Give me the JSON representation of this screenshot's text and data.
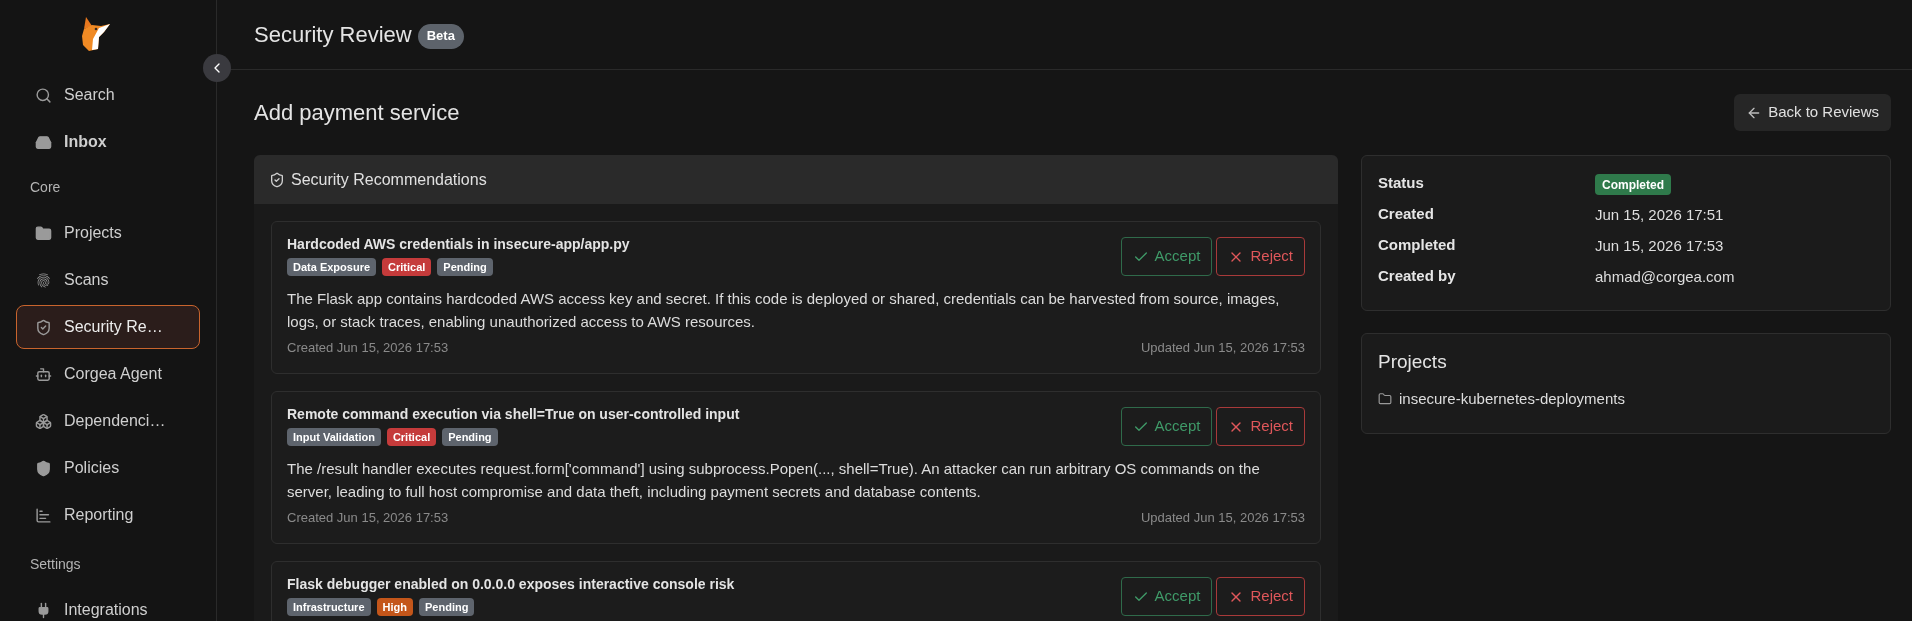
{
  "sidebar": {
    "items": [
      {
        "label": "Search",
        "selected": false,
        "unread": false
      },
      {
        "label": "Inbox",
        "selected": false,
        "unread": true
      }
    ],
    "sections": [
      {
        "title": "Core",
        "items": [
          {
            "label": "Projects",
            "selected": false,
            "unread": false
          },
          {
            "label": "Scans",
            "selected": false,
            "unread": false
          },
          {
            "label": "Security Re…",
            "selected": true,
            "unread": false
          },
          {
            "label": "Corgea Agent",
            "selected": false,
            "unread": false
          },
          {
            "label": "Dependenci…",
            "selected": false,
            "unread": false
          },
          {
            "label": "Policies",
            "selected": false,
            "unread": false
          },
          {
            "label": "Reporting",
            "selected": false,
            "unread": false
          }
        ]
      },
      {
        "title": "Settings",
        "items": [
          {
            "label": "Integrations",
            "selected": false,
            "unread": false
          }
        ]
      }
    ]
  },
  "header": {
    "title": "Security Review",
    "badge": "Beta"
  },
  "page": {
    "title": "Add payment service",
    "back_button": "Back to Reviews"
  },
  "recommendations": {
    "title": "Security Recommendations",
    "items": [
      {
        "title": "Hardcoded AWS credentials in insecure-app/app.py",
        "tags": [
          {
            "label": "Data Exposure",
            "color": "#5e646d"
          },
          {
            "label": "Critical",
            "color": "#c53b3b"
          },
          {
            "label": "Pending",
            "color": "#5e646d"
          }
        ],
        "description": "The Flask app contains hardcoded AWS access key and secret. If this code is deployed or shared, credentials can be harvested from source, images, logs, or stack traces, enabling unauthorized access to AWS resources.",
        "created": "Created Jun 15, 2026 17:53",
        "updated": "Updated Jun 15, 2026 17:53",
        "actions": [
          {
            "kind": "accept",
            "label": "Accept"
          },
          {
            "kind": "reject",
            "label": "Reject"
          }
        ]
      },
      {
        "title": "Remote command execution via shell=True on user-controlled input",
        "tags": [
          {
            "label": "Input Validation",
            "color": "#5e646d"
          },
          {
            "label": "Critical",
            "color": "#c53b3b"
          },
          {
            "label": "Pending",
            "color": "#5e646d"
          }
        ],
        "description": "The /result handler executes request.form['command'] using subprocess.Popen(..., shell=True). An attacker can run arbitrary OS commands on the server, leading to full host compromise and data theft, including payment secrets and database contents.",
        "created": "Created Jun 15, 2026 17:53",
        "updated": "Updated Jun 15, 2026 17:53",
        "actions": [
          {
            "kind": "accept",
            "label": "Accept"
          },
          {
            "kind": "reject",
            "label": "Reject"
          }
        ]
      },
      {
        "title": "Flask debugger enabled on 0.0.0.0 exposes interactive console risk",
        "tags": [
          {
            "label": "Infrastructure",
            "color": "#5e646d"
          },
          {
            "label": "High",
            "color": "#c4561a"
          },
          {
            "label": "Pending",
            "color": "#5e646d"
          }
        ],
        "actions": [
          {
            "kind": "accept",
            "label": "Accept"
          },
          {
            "kind": "reject",
            "label": "Reject"
          }
        ]
      }
    ]
  },
  "details": {
    "rows": [
      {
        "label": "Status",
        "value": "Completed",
        "kind": "badge"
      },
      {
        "label": "Created",
        "value": "Jun 15, 2026 17:51",
        "kind": "text"
      },
      {
        "label": "Completed",
        "value": "Jun 15, 2026 17:53",
        "kind": "text"
      },
      {
        "label": "Created by",
        "value": "ahmad@corgea.com",
        "kind": "text"
      }
    ]
  },
  "projects": {
    "title": "Projects",
    "items": [
      "insecure-kubernetes-deployments"
    ]
  }
}
